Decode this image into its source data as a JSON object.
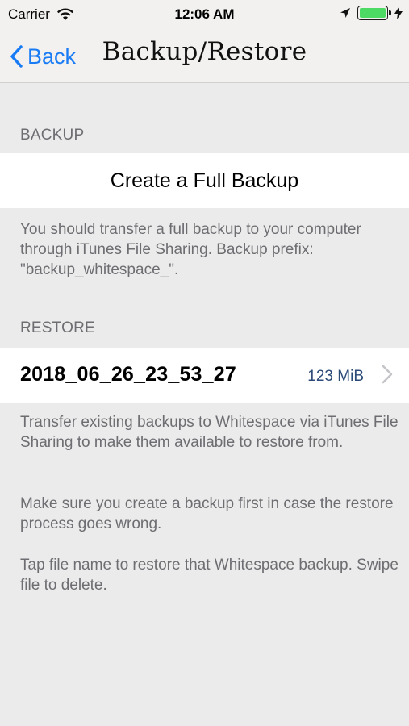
{
  "status_bar": {
    "carrier": "Carrier",
    "time": "12:06 AM",
    "battery_level": 1.0
  },
  "nav": {
    "back_label": "Back",
    "title": "Backup/Restore"
  },
  "backup_section": {
    "header": "BACKUP",
    "button_label": "Create a Full Backup",
    "footer": "You should transfer a full backup to your computer through iTunes File Sharing. Backup prefix: \"backup_whitespace_\"."
  },
  "restore_section": {
    "header": "RESTORE",
    "rows": [
      {
        "name": "2018_06_26_23_53_27",
        "size": "123 MiB"
      }
    ],
    "footer_1": "Transfer existing backups to Whitespace via iTunes File Sharing to make them available to restore from.",
    "footer_2": "Make sure you create a backup first in case the restore process goes wrong.",
    "footer_3": "Tap file name to restore that Whitespace backup. Swipe file to delete."
  },
  "colors": {
    "accent": "#1a7cf5",
    "background": "#ebebeb",
    "battery": "#4cd964"
  }
}
